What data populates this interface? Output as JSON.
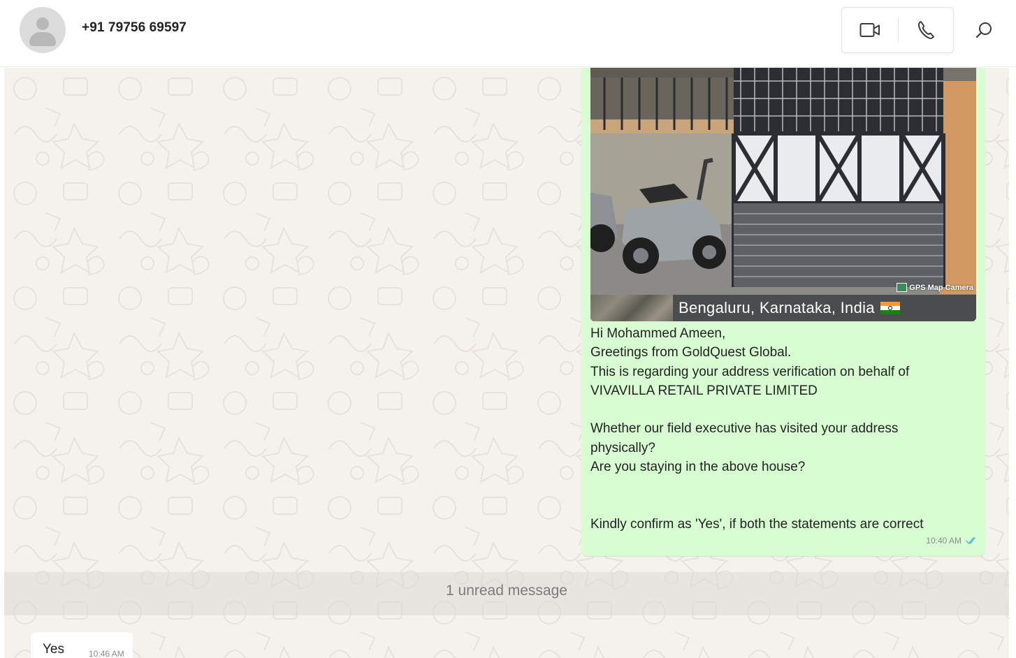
{
  "header": {
    "contact_name": "+91 79756 69597",
    "icons": {
      "avatar": "person-icon",
      "video": "video-icon",
      "voice": "phone-icon",
      "search": "search-icon"
    }
  },
  "chat": {
    "outgoing_message": {
      "photo": {
        "location": "Bengaluru, Karnataka, India",
        "badge": "GPS Map Camera"
      },
      "lines": [
        "Hi Mohammed Ameen,",
        "Greetings from GoldQuest Global.",
        "This is regarding your address verification on behalf of",
        "VIVAVILLA RETAIL PRIVATE LIMITED",
        "",
        "Whether our field executive has visited your address",
        "physically?",
        "Are you staying in the above house?",
        "",
        "",
        "Kindly confirm as 'Yes', if both the statements are correct"
      ],
      "time": "10:40 AM",
      "status_icon": "double-tick-icon"
    },
    "unread_divider": "1 unread message",
    "incoming_message": {
      "text": "Yes",
      "time": "10:46 AM"
    }
  },
  "colors": {
    "outgoing_bubble": "#d8fdd2",
    "incoming_bubble": "#ffffff",
    "chat_background": "#f5f2ee",
    "read_tick": "#53bdeb"
  }
}
